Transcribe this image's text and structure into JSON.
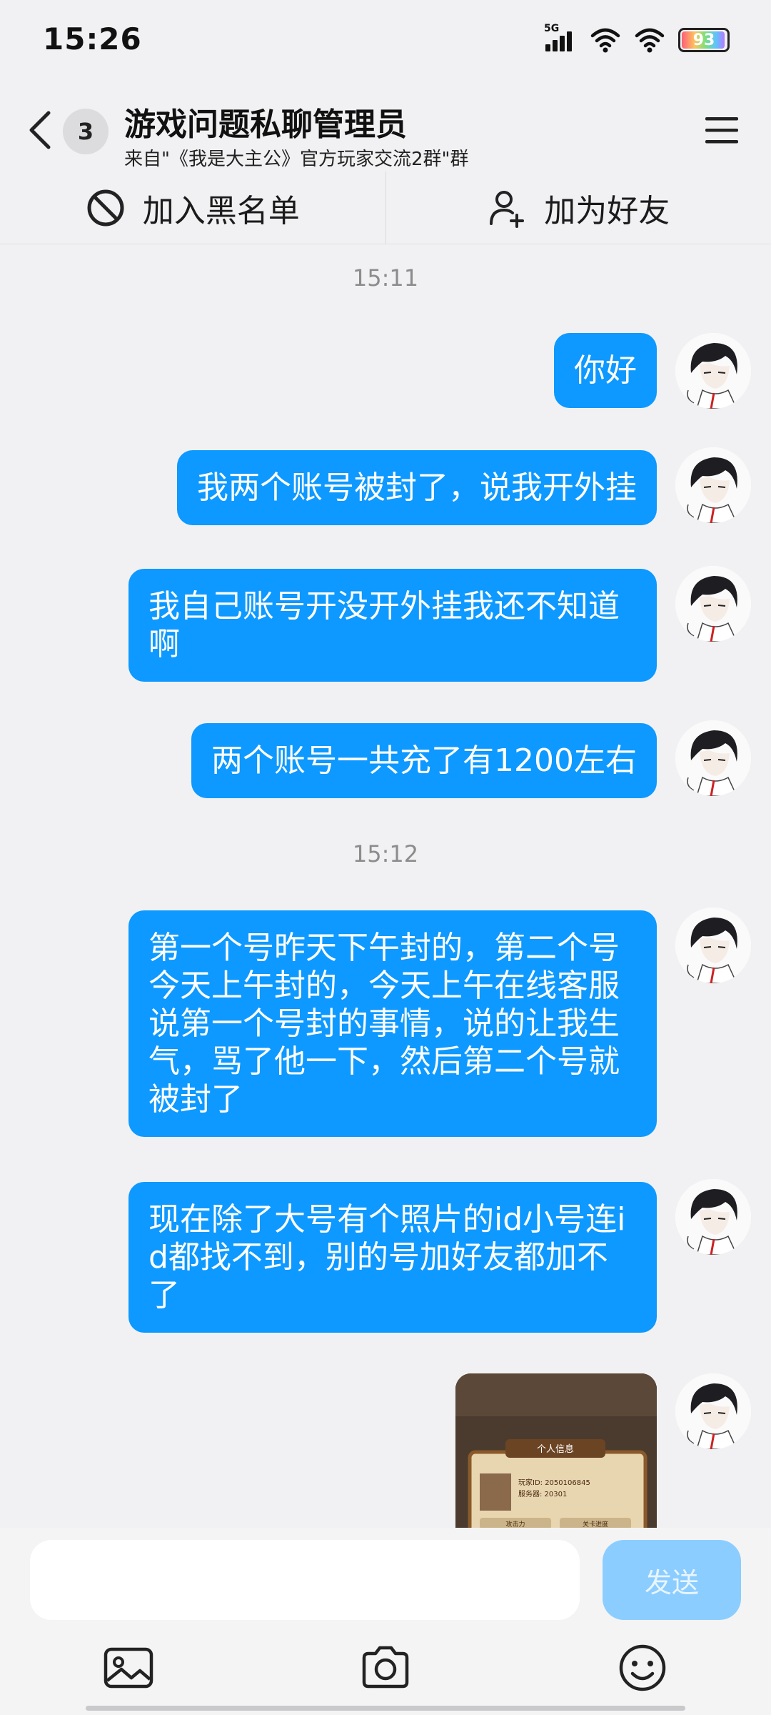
{
  "status_bar": {
    "time": "15:26",
    "network": "5G",
    "battery": "93",
    "icons": [
      "signal-icon",
      "wifi-icon",
      "wifi-icon",
      "battery-icon"
    ]
  },
  "header": {
    "badge_count": "3",
    "title": "游戏问题私聊管理员",
    "subtitle": "来自\"《我是大主公》官方玩家交流2群\"群",
    "icons": [
      "back-arrow-icon",
      "menu-icon"
    ]
  },
  "actions": {
    "block_label": "加入黑名单",
    "add_friend_label": "加为好友",
    "icons": [
      "block-icon",
      "add-user-icon"
    ]
  },
  "chat": {
    "timestamps": [
      "15:11",
      "15:12"
    ],
    "messages": [
      "你好",
      "我两个账号被封了，说我开外挂",
      "我自己账号开没开外挂我还不知道啊",
      "两个账号一共充了有1200左右",
      "第一个号昨天下午封的，第二个号今天上午封的，今天上午在线客服说第一个号封的事情，说的让我生气，骂了他一下，然后第二个号就被封了",
      "现在除了大号有个照片的id小号连id都找不到，别的号加好友都加不了"
    ],
    "image_message": {
      "banner": "个人信息",
      "line1": "玩家ID: 2050106845",
      "line2": "服务器: 20301",
      "tab1": "攻击力",
      "tab2": "关卡进度"
    }
  },
  "input_bar": {
    "placeholder": "",
    "send_label": "发送",
    "tools": [
      "image-icon",
      "camera-icon",
      "emoji-icon"
    ]
  },
  "colors": {
    "bubble": "#0d99ff",
    "send_disabled": "#8ccdff",
    "background": "#f1f1f3"
  }
}
